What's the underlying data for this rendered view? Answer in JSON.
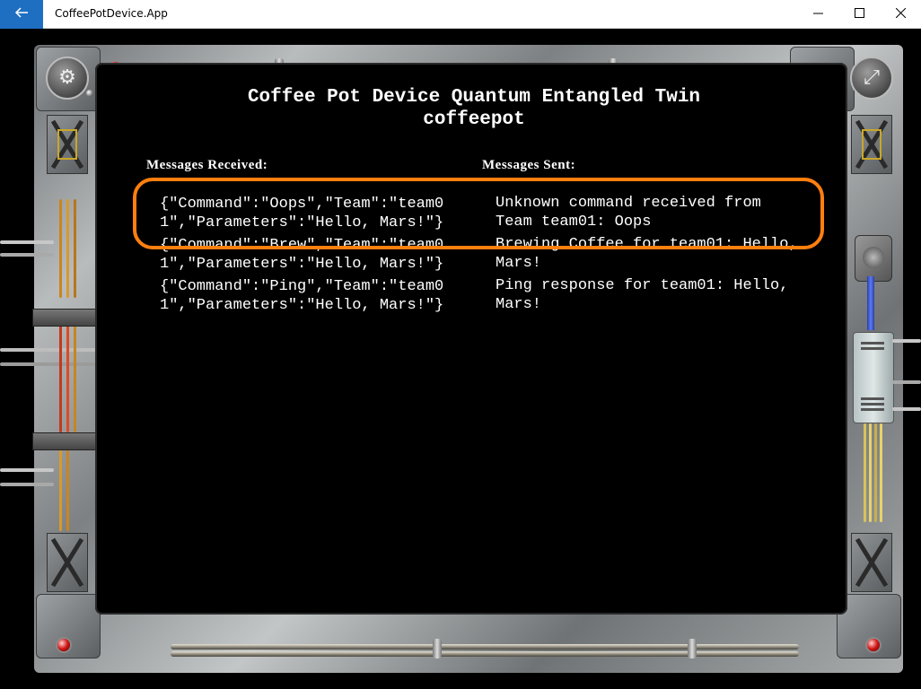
{
  "window": {
    "title": "CoffeePotDevice.App"
  },
  "heading": {
    "line1": "Coffee Pot Device Quantum Entangled Twin",
    "line2": "coffeepot"
  },
  "received": {
    "title": "Messages Received:",
    "items": [
      "{\"Command\":\"Oops\",\"Team\":\"team01\",\"Parameters\":\"Hello, Mars!\"}",
      "{\"Command\":\"Brew\",\"Team\":\"team01\",\"Parameters\":\"Hello, Mars!\"}",
      "{\"Command\":\"Ping\",\"Team\":\"team01\",\"Parameters\":\"Hello, Mars!\"}"
    ]
  },
  "sent": {
    "title": "Messages Sent:",
    "items": [
      "Unknown command received from Team team01: Oops",
      "Brewing Coffee for team01: Hello, Mars!",
      "Ping response for team01: Hello, Mars!"
    ]
  },
  "colors": {
    "highlight": "#ff7f0e",
    "back_button": "#1e6fc2"
  },
  "icons": {
    "back": "arrow-left-icon",
    "settings": "gear-icon",
    "fullscreen": "expand-icon"
  }
}
